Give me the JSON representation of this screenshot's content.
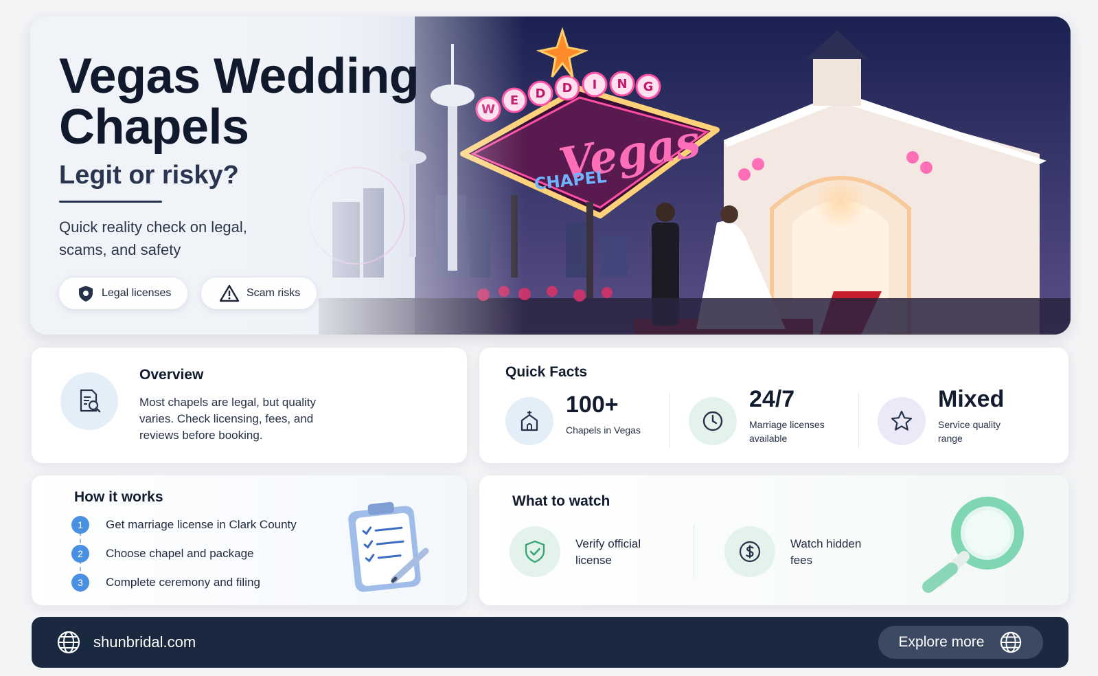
{
  "hero": {
    "title": "Vegas Wedding Chapels",
    "subtitle": "Legit or risky?",
    "description": "Quick reality check on legal, scams, and safety",
    "pills": [
      {
        "label": "Legal licenses",
        "icon": "shield-icon"
      },
      {
        "label": "Scam risks",
        "icon": "warning-icon"
      }
    ],
    "image": {
      "sign_top": "WEDDING",
      "sign_main": "Vegas",
      "sign_bottom": "CHAPEL"
    }
  },
  "overview": {
    "title": "Overview",
    "text": "Most chapels are legal, but quality varies. Check licensing, fees, and reviews before booking.",
    "icon": "document-search-icon"
  },
  "quick_facts": {
    "title": "Quick Facts",
    "items": [
      {
        "value": "100+",
        "label": "Chapels in Vegas",
        "icon": "chapel-icon",
        "color": "#e4eef8"
      },
      {
        "value": "24/7",
        "label": "Marriage licenses available",
        "icon": "clock-icon",
        "color": "#e3f3ec"
      },
      {
        "value": "Mixed",
        "label": "Service quality range",
        "icon": "star-icon",
        "color": "#ebe8f8"
      }
    ]
  },
  "how_it_works": {
    "title": "How it works",
    "steps": [
      {
        "num": "1",
        "text": "Get marriage license in Clark County"
      },
      {
        "num": "2",
        "text": "Choose chapel and package"
      },
      {
        "num": "3",
        "text": "Complete ceremony and filing"
      }
    ],
    "illustration": "clipboard-checklist-icon"
  },
  "what_to_watch": {
    "title": "What to watch",
    "items": [
      {
        "text": "Verify official license",
        "icon": "shield-check-icon"
      },
      {
        "text": "Watch hidden fees",
        "icon": "dollar-icon"
      }
    ],
    "illustration": "magnifier-icon"
  },
  "footer": {
    "site": "shunbridal.com",
    "cta": "Explore more"
  },
  "colors": {
    "accent_blue": "#4a90e2",
    "footer_bg": "#1b2940",
    "neon_pink": "#ff4fa3",
    "neon_blue": "#5aa8ff",
    "teal": "#3aa57a"
  }
}
